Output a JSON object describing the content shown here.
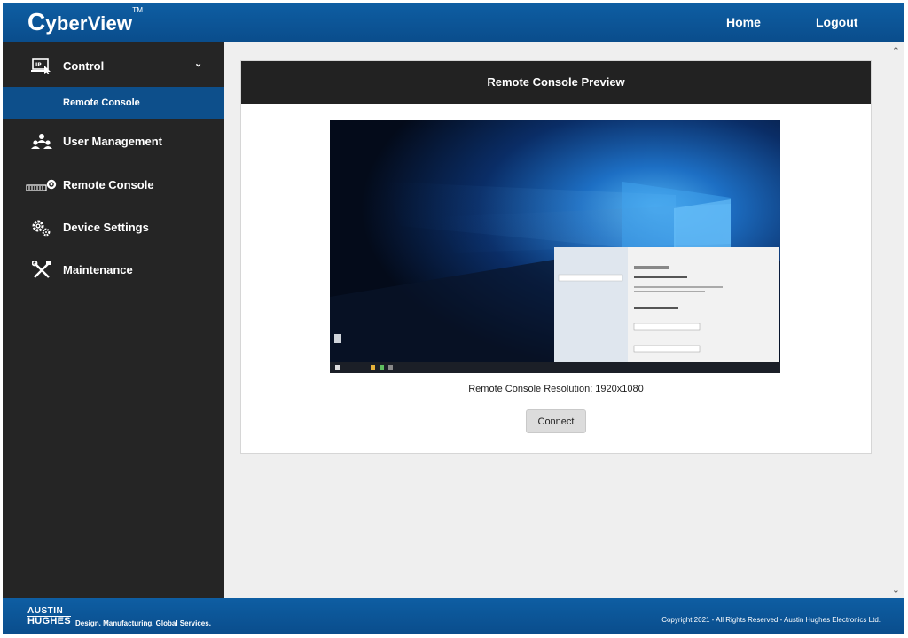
{
  "header": {
    "logo_initial": "C",
    "logo_rest": "yberView",
    "logo_tm": "TM",
    "nav_home": "Home",
    "nav_logout": "Logout"
  },
  "sidebar": {
    "items": [
      {
        "label": "Control",
        "icon": "monitor-cursor-icon",
        "expanded": true
      },
      {
        "label": "User Management",
        "icon": "users-icon"
      },
      {
        "label": "Remote Console",
        "icon": "kvm-gear-icon"
      },
      {
        "label": "Device Settings",
        "icon": "gears-icon"
      },
      {
        "label": "Maintenance",
        "icon": "tools-icon"
      }
    ],
    "sub_items": [
      {
        "label": "Remote Console",
        "active": true
      }
    ]
  },
  "main": {
    "panel_title": "Remote Console Preview",
    "resolution_text": "Remote Console Resolution: 1920x1080",
    "connect_label": "Connect"
  },
  "footer": {
    "brand_line1": "AUSTIN",
    "brand_line2": "HUGHES",
    "tagline": "Design. Manufacturing. Global Services.",
    "copyright": "Copyright 2021 - All Rights Reserved - Austin Hughes Electronics Ltd."
  },
  "colors": {
    "primary_blue": "#0b5394",
    "sidebar_dark": "#252525",
    "panel_header": "#222222",
    "active_sub": "#0d4f8b"
  }
}
